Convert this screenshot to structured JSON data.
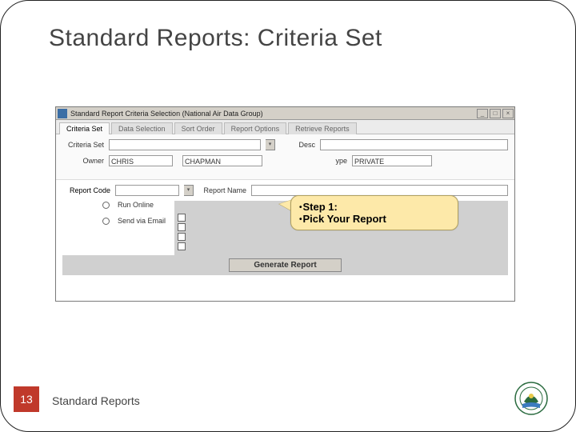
{
  "slide": {
    "title": "Standard Reports: Criteria Set",
    "page_number": "13",
    "footer_label": "Standard Reports"
  },
  "window": {
    "title": "Standard Report Criteria Selection  (National Air Data Group)",
    "tabs": [
      "Criteria Set",
      "Data Selection",
      "Sort Order",
      "Report Options",
      "Retrieve Reports"
    ],
    "active_tab": 0
  },
  "fields": {
    "criteria_set_label": "Criteria Set",
    "criteria_set_value": "",
    "desc_label": "Desc",
    "desc_value": "",
    "owner_label": "Owner",
    "owner_first": "CHRIS",
    "owner_last": "CHAPMAN",
    "type_label": "ype",
    "type_value": "PRIVATE",
    "report_code_label": "Report Code",
    "report_code_value": "",
    "report_name_label": "Report Name",
    "report_name_value": ""
  },
  "options": {
    "run_online_label": "Run Online",
    "send_email_label": "Send via Email"
  },
  "generate_button": "Generate Report",
  "callout": {
    "line1": "Step 1:",
    "line2": "Pick Your Report"
  }
}
